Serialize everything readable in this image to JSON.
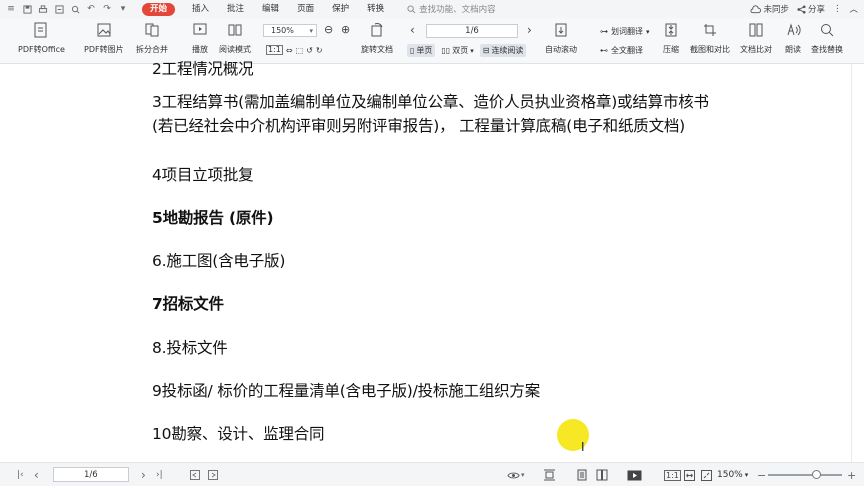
{
  "menubar": {
    "quick_access": [
      "menu-icon",
      "save-icon",
      "print-icon",
      "export-icon",
      "print-preview-icon",
      "undo-icon",
      "redo-icon",
      "dropdown-icon"
    ],
    "tabs": [
      {
        "label": "开始",
        "active": true
      },
      {
        "label": "插入",
        "active": false
      },
      {
        "label": "批注",
        "active": false
      },
      {
        "label": "编辑",
        "active": false
      },
      {
        "label": "页面",
        "active": false
      },
      {
        "label": "保护",
        "active": false
      },
      {
        "label": "转换",
        "active": false
      }
    ],
    "search_text": "查找功能、文档内容",
    "sync_label": "未同步",
    "share_label": "分享"
  },
  "ribbon": {
    "pdf_to_office": "PDF转Office",
    "pdf_to_image": "PDF转图片",
    "split_merge": "拆分合并",
    "play": "播放",
    "read_mode": "阅读模式",
    "zoom": "150%",
    "rotate": "旋转文档",
    "page_indicator": "1/6",
    "single_page": "单页",
    "double_page": "双页",
    "continuous": "连续阅读",
    "auto_scroll": "自动滚动",
    "translate_word": "划词翻译",
    "translate_full": "全文翻译",
    "compress": "压缩",
    "screenshot_compare": "截图和对比",
    "doc_compare": "文档比对",
    "read_aloud": "朗读",
    "find_replace": "查找替换"
  },
  "document": {
    "lines": [
      {
        "text": "2工程情况概况",
        "bold": false
      },
      {
        "text": "3工程结算书(需加盖编制单位及编制单位公章、造价人员执业资格章)或结算市核书",
        "bold": false
      },
      {
        "text": "(若已经社会中介机构评审则另附评审报告)， 工程量计算底稿(电子和纸质文档)",
        "bold": false
      },
      {
        "text": "4项目立项批复",
        "bold": false
      },
      {
        "text": "5地勘报告 (原件)",
        "bold": true
      },
      {
        "text": "6.施工图(含电子版)",
        "bold": false
      },
      {
        "text": "7招标文件",
        "bold": true
      },
      {
        "text": "8.投标文件",
        "bold": false
      },
      {
        "text": "9投标函/ 标价的工程量清单(含电子版)/投标施工组织方案",
        "bold": false
      },
      {
        "text": "10勘察、设计、监理合同",
        "bold": false
      }
    ]
  },
  "statusbar": {
    "page": "1/6",
    "zoom": "150%",
    "zoom_fraction": 0.65
  }
}
